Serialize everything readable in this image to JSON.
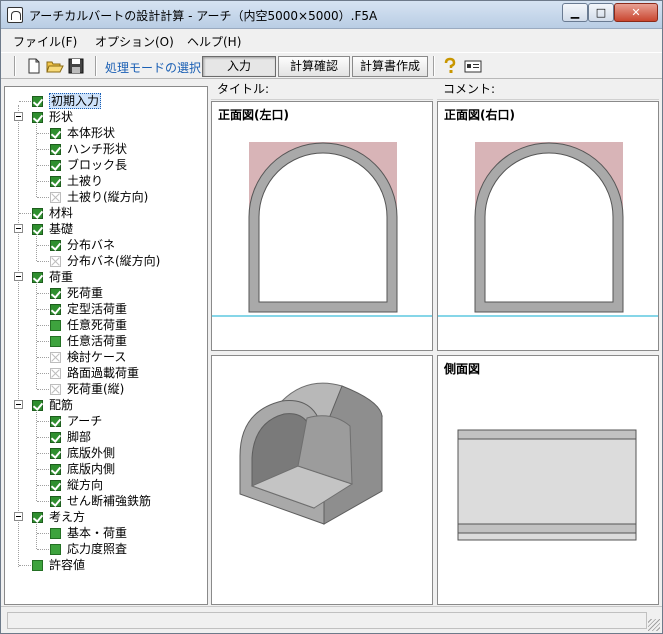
{
  "window": {
    "title": "アーチカルバートの設計計算 - アーチ（内空5000×5000）.F5A"
  },
  "menu": [
    {
      "label": "ファイル(F)"
    },
    {
      "label": "オプション(O)"
    },
    {
      "label": "ヘルプ(H)"
    }
  ],
  "toolbar": {
    "mode_label": "処理モードの選択",
    "input_label": "入力",
    "check_label": "計算確認",
    "report_label": "計算書作成"
  },
  "tree": [
    {
      "label": "初期入力",
      "state": "checked",
      "selected": true
    },
    {
      "label": "形状",
      "state": "checked"
    },
    {
      "label": "本体形状",
      "state": "checked"
    },
    {
      "label": "ハンチ形状",
      "state": "checked"
    },
    {
      "label": "ブロック長",
      "state": "checked"
    },
    {
      "label": "土被り",
      "state": "checked"
    },
    {
      "label": "土被り(縦方向)",
      "state": "disabled"
    },
    {
      "label": "材料",
      "state": "checked"
    },
    {
      "label": "基礎",
      "state": "checked"
    },
    {
      "label": "分布バネ",
      "state": "checked"
    },
    {
      "label": "分布バネ(縦方向)",
      "state": "disabled"
    },
    {
      "label": "荷重",
      "state": "checked"
    },
    {
      "label": "死荷重",
      "state": "checked"
    },
    {
      "label": "定型活荷重",
      "state": "checked"
    },
    {
      "label": "任意死荷重",
      "state": "green"
    },
    {
      "label": "任意活荷重",
      "state": "green"
    },
    {
      "label": "検討ケース",
      "state": "disabled"
    },
    {
      "label": "路面過載荷重",
      "state": "disabled"
    },
    {
      "label": "死荷重(縦)",
      "state": "disabled"
    },
    {
      "label": "配筋",
      "state": "checked"
    },
    {
      "label": "アーチ",
      "state": "checked"
    },
    {
      "label": "脚部",
      "state": "checked"
    },
    {
      "label": "底版外側",
      "state": "checked"
    },
    {
      "label": "底版内側",
      "state": "checked"
    },
    {
      "label": "縦方向",
      "state": "checked"
    },
    {
      "label": "せん断補強鉄筋",
      "state": "checked"
    },
    {
      "label": "考え方",
      "state": "checked"
    },
    {
      "label": "基本・荷重",
      "state": "green"
    },
    {
      "label": "応力度照査",
      "state": "green"
    },
    {
      "label": "許容値",
      "state": "green"
    }
  ],
  "headers": {
    "title_label": "タイトル:",
    "comment_label": "コメント:"
  },
  "views": {
    "front_left": "正面図(左口)",
    "front_right": "正面図(右口)",
    "side": "側面図"
  },
  "colors": {
    "soil": "#d8b4b7",
    "culvert": "#a9a9a9",
    "ground_line": "#5ec8e0",
    "check_green": "#2f8f2f",
    "mode_blue": "#1a5fb4"
  }
}
